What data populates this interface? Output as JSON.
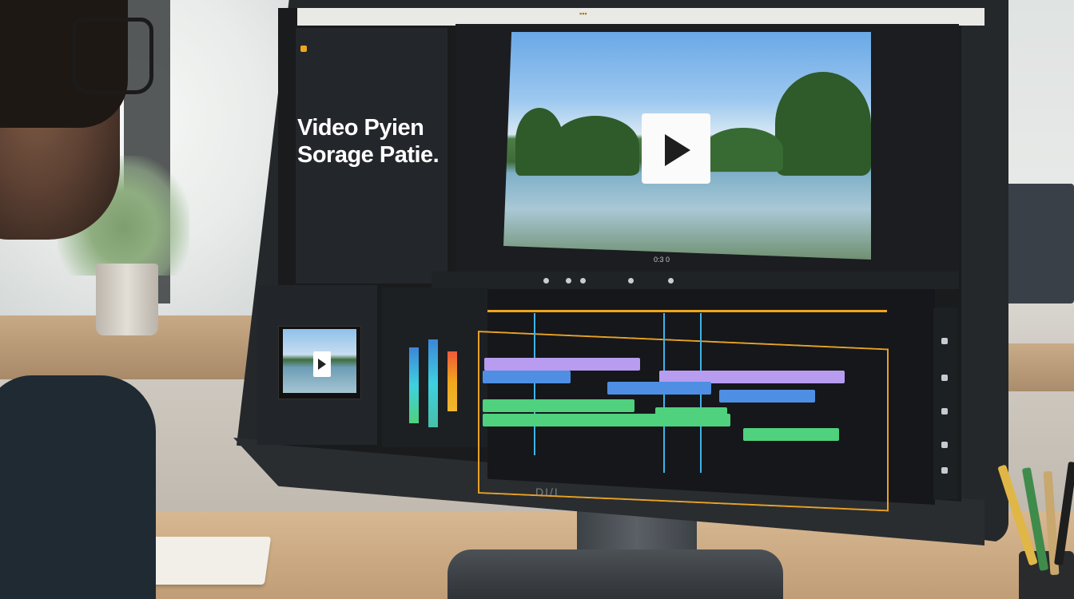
{
  "screen_title": "Video Pyien Sorage Patie.",
  "title_lines": [
    "Video Pyien",
    "Sorage Patie."
  ],
  "monitor_brand": "DI/I",
  "timecode": "0:3 0",
  "colors": {
    "accent_orange": "#f0a61c",
    "clip_purple": "#b79cf0",
    "clip_blue": "#4e8fe3",
    "clip_green": "#4fd17e",
    "playhead_cyan": "#3fb3e8"
  },
  "icons": [
    "play-icon",
    "play-icon-small"
  ]
}
